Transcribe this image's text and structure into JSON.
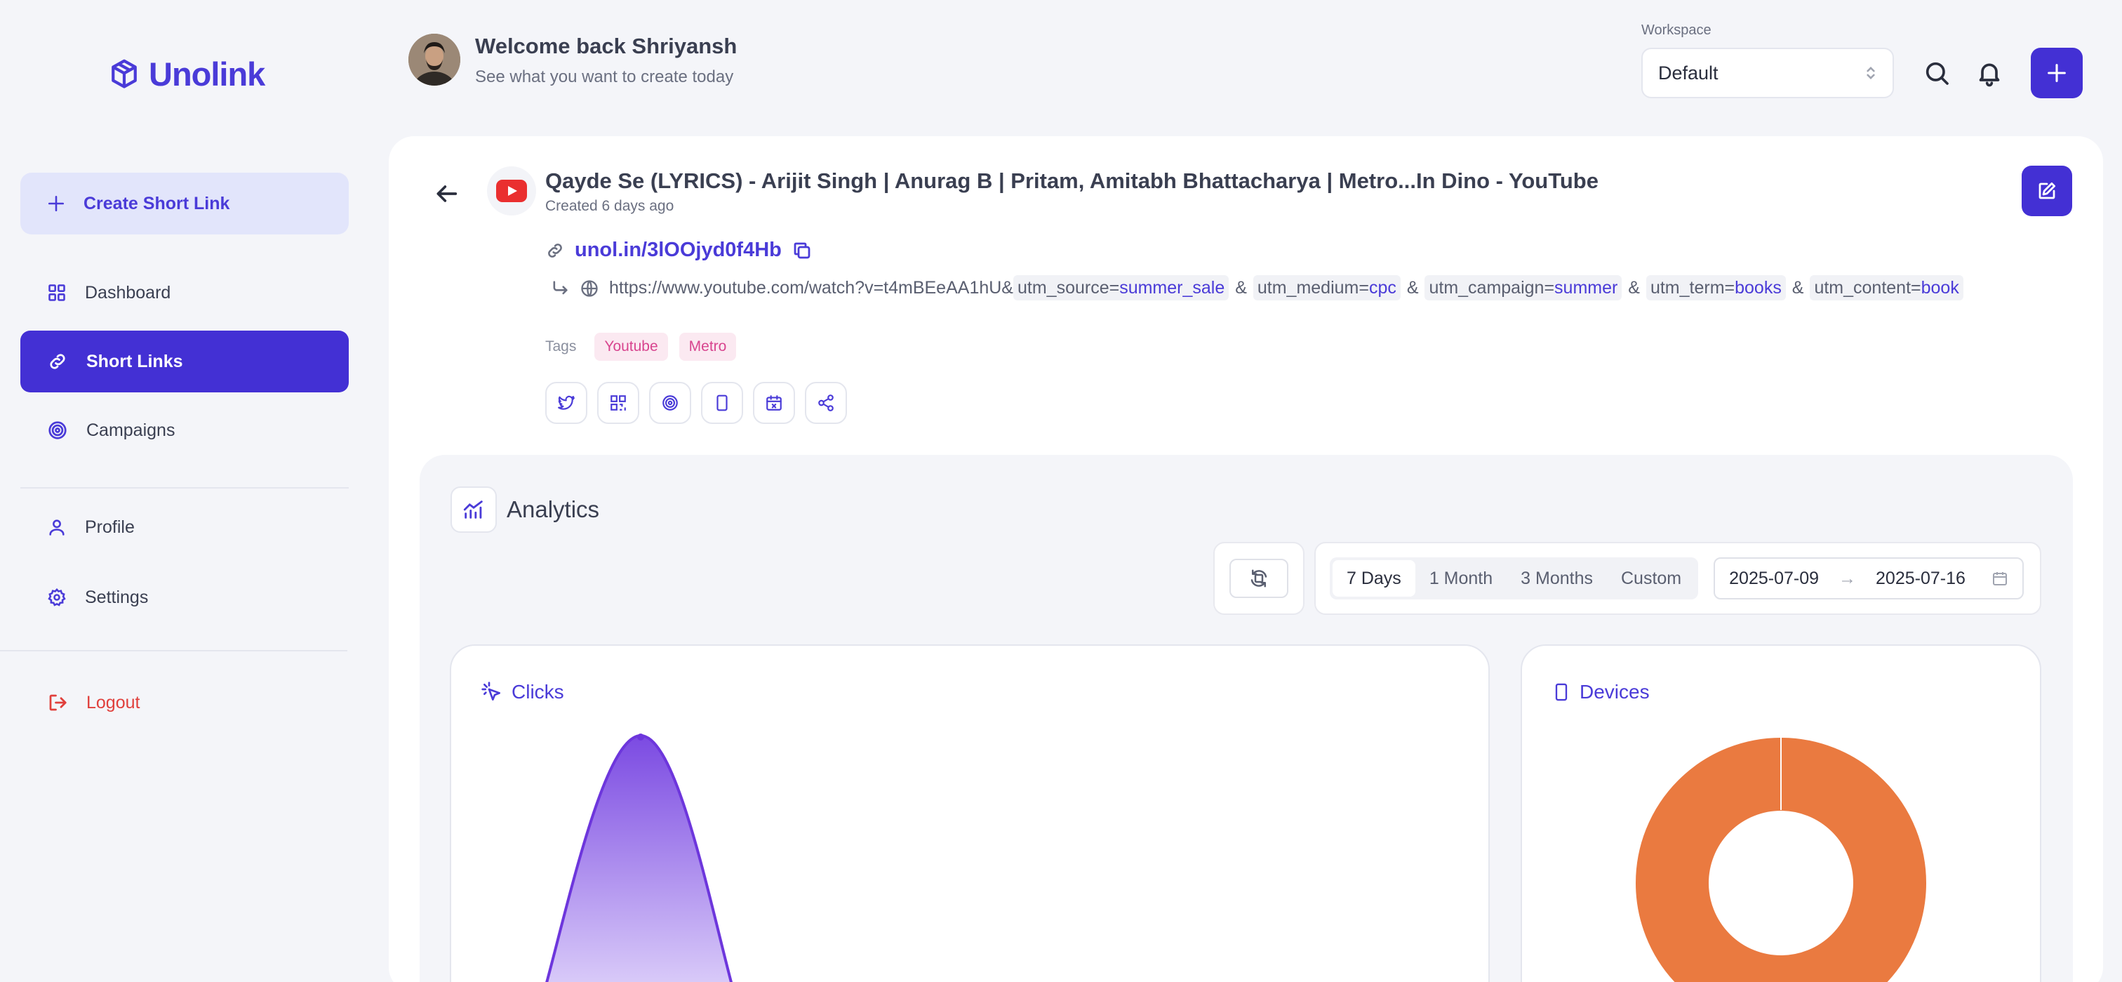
{
  "brand": {
    "name": "Unolink"
  },
  "sidebar": {
    "create_label": "Create Short Link",
    "items": [
      {
        "label": "Dashboard"
      },
      {
        "label": "Short Links"
      },
      {
        "label": "Campaigns"
      },
      {
        "label": "Profile"
      },
      {
        "label": "Settings"
      },
      {
        "label": "Logout"
      }
    ]
  },
  "header": {
    "welcome": "Welcome back Shriyansh",
    "subtitle": "See what you want to create today",
    "workspace_label": "Workspace",
    "workspace_value": "Default"
  },
  "link": {
    "title": "Qayde Se (LYRICS) - Arijit Singh | Anurag B | Pritam, Amitabh Bhattacharya | Metro...In Dino - YouTube",
    "created": "Created 6 days ago",
    "short_url": "unol.in/3lOOjyd0f4Hb",
    "long_url_base": "https://www.youtube.com/watch?v=t4mBEeAA1hU&",
    "utm": [
      {
        "key": "utm_source=",
        "value": "summer_sale"
      },
      {
        "key": "utm_medium=",
        "value": "cpc"
      },
      {
        "key": "utm_campaign=",
        "value": "summer"
      },
      {
        "key": "utm_term=",
        "value": "books"
      },
      {
        "key": "utm_content=",
        "value": "book"
      }
    ],
    "amp": "&",
    "tags_label": "Tags",
    "tags": [
      "Youtube",
      "Metro"
    ]
  },
  "analytics": {
    "title": "Analytics",
    "ranges": [
      "7 Days",
      "1 Month",
      "3 Months",
      "Custom"
    ],
    "selected_range": "7 Days",
    "date_from": "2025-07-09",
    "date_to": "2025-07-16",
    "date_arrow": "→",
    "clicks_title": "Clicks",
    "devices_title": "Devices"
  },
  "colors": {
    "accent": "#4330d4",
    "brand": "#4a3bd8",
    "logout": "#e0403c",
    "donut": "#ea7a40",
    "area_top": "#7b4ae2",
    "tag_text": "#d8458f"
  }
}
